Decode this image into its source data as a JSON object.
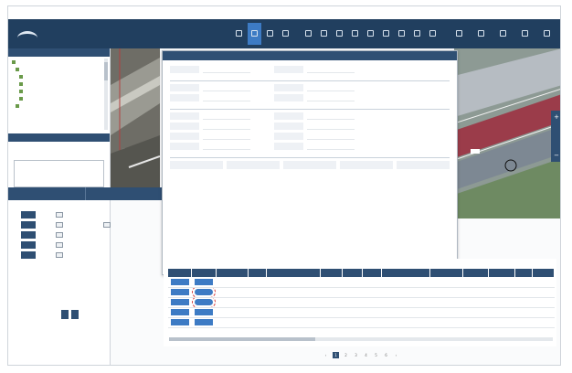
{
  "topbar": {
    "links": [
      "",
      "",
      ""
    ]
  },
  "header": {
    "app_title": "",
    "toolbar": [
      {
        "label": ""
      },
      {
        "label": ""
      },
      {
        "label": ""
      },
      {
        "label": ""
      },
      {
        "label": ""
      },
      {
        "label": ""
      },
      {
        "label": ""
      },
      {
        "label": ""
      },
      {
        "label": ""
      },
      {
        "label": ""
      },
      {
        "label": ""
      },
      {
        "label": ""
      },
      {
        "label": ""
      },
      {
        "label": ""
      },
      {
        "label": ""
      },
      {
        "label": ""
      },
      {
        "label": ""
      },
      {
        "label": ""
      }
    ],
    "active_index": 1
  },
  "left": {
    "tree_title": "",
    "layer_title": "",
    "tabs": [
      "",
      ""
    ],
    "form_labels": [
      "",
      "",
      "",
      "",
      ""
    ],
    "buttons": [
      "",
      ""
    ]
  },
  "dialog": {
    "title": "",
    "footer_buttons": [
      "",
      "",
      ""
    ]
  },
  "table": {
    "count_text": "",
    "pages": [
      "1",
      "2",
      "3",
      "4",
      "5",
      "6"
    ],
    "current_page": 1
  },
  "colors": {
    "header_bg": "#213f5f",
    "accent": "#3d7bc4",
    "panel": "#2f4f73",
    "highlight": "#d23b3b"
  }
}
